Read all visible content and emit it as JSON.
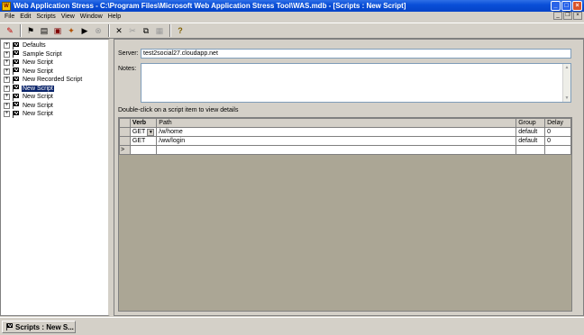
{
  "window": {
    "title": "Web Application Stress - C:\\Program Files\\Microsoft Web Application Stress Tool\\WAS.mdb - [Scripts : New Script]",
    "buttons": [
      "_",
      "□",
      "×"
    ]
  },
  "menu": [
    "File",
    "Edit",
    "Scripts",
    "View",
    "Window",
    "Help"
  ],
  "toolbar": {
    "icons": [
      "record-icon",
      "new-script-icon",
      "open-icon",
      "save-icon",
      "import-icon",
      "run-icon",
      "stop-icon",
      "delete-icon",
      "cut-icon",
      "copy-icon",
      "paste-icon",
      "help-icon"
    ]
  },
  "tree": {
    "items": [
      {
        "label": "Defaults",
        "expander": "+",
        "selected": false
      },
      {
        "label": "Sample Script",
        "expander": "+",
        "selected": false
      },
      {
        "label": "New Script",
        "expander": "+",
        "selected": false
      },
      {
        "label": "New Script",
        "expander": "+",
        "selected": false
      },
      {
        "label": "New Recorded Script",
        "expander": "+",
        "selected": false
      },
      {
        "label": "New Script",
        "expander": "+",
        "selected": true
      },
      {
        "label": "New Script",
        "expander": "+",
        "selected": false
      },
      {
        "label": "New Script",
        "expander": "+",
        "selected": false
      },
      {
        "label": "New Script",
        "expander": "+",
        "selected": false
      }
    ]
  },
  "detail": {
    "server_label": "Server:",
    "server_value": "test2social27.cloudapp.net",
    "notes_label": "Notes:",
    "notes_value": "",
    "hint": "Double-click on a script item to view details"
  },
  "grid": {
    "headers": {
      "verb": "Verb",
      "path": "Path",
      "group": "Group",
      "delay": "Delay"
    },
    "rows": [
      {
        "marker": "",
        "verb": "GET",
        "path": "/w/home",
        "group": "default",
        "delay": "0"
      },
      {
        "marker": "",
        "verb": "GET",
        "path": "/ww/login",
        "group": "default",
        "delay": "0"
      },
      {
        "marker": ">",
        "verb": "",
        "path": "",
        "group": "",
        "delay": ""
      }
    ]
  },
  "taskbar": {
    "tab_label": "Scripts : New S..."
  }
}
